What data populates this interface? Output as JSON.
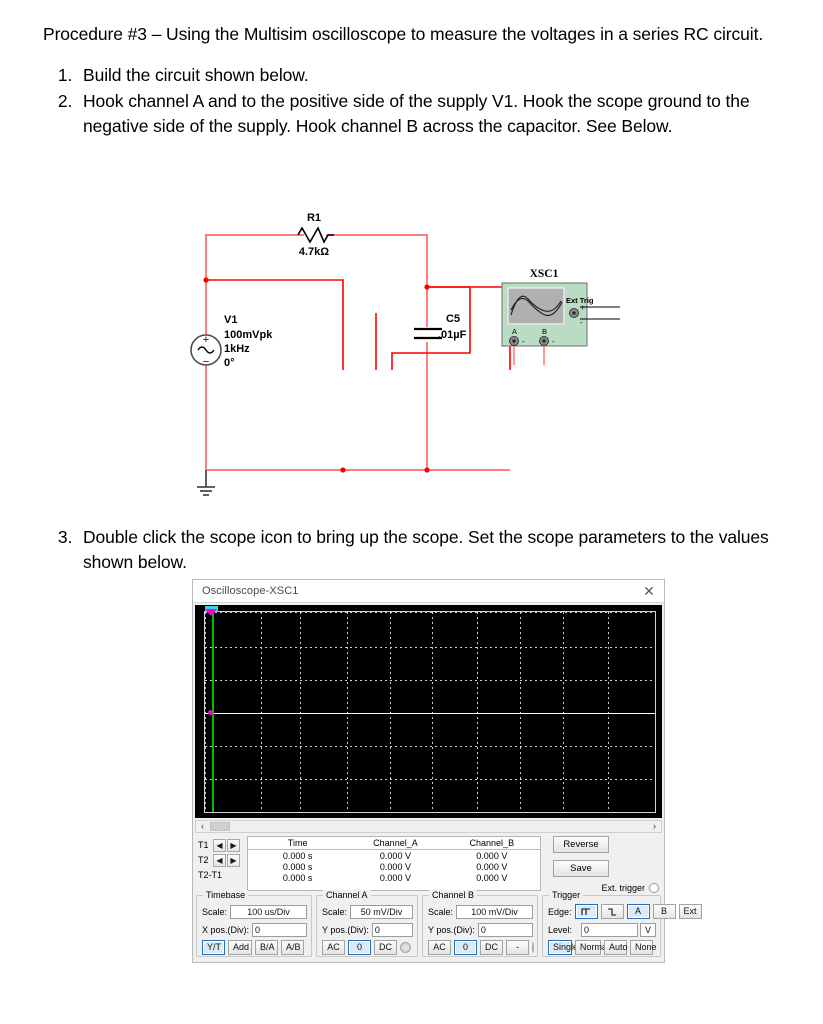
{
  "document": {
    "intro": "Procedure #3 – Using the Multisim oscilloscope to measure the voltages in a series RC circuit.",
    "steps": [
      "Build the circuit shown below.",
      "Hook channel A and to the positive side of the supply V1. Hook the scope ground to the negative side of the supply. Hook channel B across the capacitor. See Below."
    ],
    "step3": "Double click the scope icon to bring up the scope. Set the scope parameters to the values shown below."
  },
  "circuit": {
    "resistor": {
      "ref": "R1",
      "value": "4.7kΩ"
    },
    "capacitor": {
      "ref": "C5",
      "value": ".01µF"
    },
    "source": {
      "ref": "V1",
      "amplitude": "100mVpk",
      "frequency": "1kHz",
      "phase": "0°",
      "plus": "+",
      "minus": "−"
    },
    "scope_icon": {
      "ref": "XSC1",
      "terminal_a": "A",
      "terminal_b": "B",
      "ext_trig": "Ext Trig",
      "plus": "+",
      "minus": "-"
    },
    "wire_color": "#ff7f7f",
    "wire_color_dark": "#ff0000"
  },
  "scope": {
    "title": "Oscilloscope-XSC1",
    "close_icon": "close-icon",
    "scroll": {
      "left_icon": "‹",
      "right_icon": "›"
    },
    "cursors": {
      "t1_label": "T1",
      "t2_label": "T2",
      "diff_label": "T2-T1",
      "left_arrow": "◀",
      "right_arrow": "▶"
    },
    "readout": {
      "headers": [
        "Time",
        "Channel_A",
        "Channel_B"
      ],
      "rows": [
        [
          "0.000 s",
          "0.000 V",
          "0.000 V"
        ],
        [
          "0.000 s",
          "0.000 V",
          "0.000 V"
        ],
        [
          "0.000 s",
          "0.000 V",
          "0.000 V"
        ]
      ]
    },
    "side": {
      "reverse": "Reverse",
      "save": "Save",
      "ext_trigger": "Ext. trigger"
    },
    "timebase": {
      "title": "Timebase",
      "scale_label": "Scale:",
      "scale_value": "100 us/Div",
      "xpos_label": "X pos.(Div):",
      "xpos_value": "0",
      "modes": [
        "Y/T",
        "Add",
        "B/A",
        "A/B"
      ],
      "mode_selected": "Y/T"
    },
    "channel_a": {
      "title": "Channel A",
      "scale_label": "Scale:",
      "scale_value": "50 mV/Div",
      "ypos_label": "Y pos.(Div):",
      "ypos_value": "0",
      "coupling": [
        "AC",
        "0",
        "DC"
      ],
      "coupling_selected": "0",
      "indicator": "channel-a-color-indicator"
    },
    "channel_b": {
      "title": "Channel B",
      "scale_label": "Scale:",
      "scale_value": "100 mV/Div",
      "ypos_label": "Y pos.(Div):",
      "ypos_value": "0",
      "coupling": [
        "AC",
        "0",
        "DC",
        "-"
      ],
      "coupling_selected": "0",
      "indicator": "channel-b-color-indicator"
    },
    "trigger": {
      "title": "Trigger",
      "edge_label": "Edge:",
      "edge_icons": [
        "rising-edge-icon",
        "falling-edge-icon"
      ],
      "edge_sources": [
        "A",
        "B",
        "Ext"
      ],
      "edge_selected": "A",
      "edge_icon_selected": "rising-edge-icon",
      "level_label": "Level:",
      "level_value": "0",
      "level_unit": "V",
      "modes": [
        "Single",
        "Normal",
        "Auto",
        "None"
      ],
      "mode_selected": "Single"
    }
  }
}
